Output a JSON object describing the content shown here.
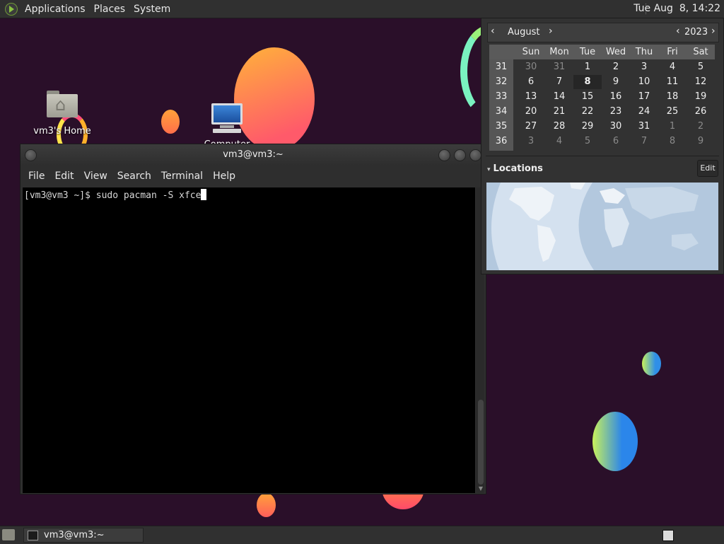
{
  "top_panel": {
    "menus": [
      "Applications",
      "Places",
      "System"
    ],
    "clock": "Tue Aug  8, 14:22"
  },
  "desktop": {
    "icons": [
      {
        "label": "vm3's Home",
        "icon": "home-folder-icon"
      },
      {
        "label": "Computer",
        "icon": "computer-icon"
      }
    ]
  },
  "terminal": {
    "title": "vm3@vm3:~",
    "menu": [
      "File",
      "Edit",
      "View",
      "Search",
      "Terminal",
      "Help"
    ],
    "line": "[vm3@vm3 ~]$ sudo pacman -S xfce"
  },
  "calendar": {
    "month": "August",
    "year": "2023",
    "weekdays": [
      "Sun",
      "Mon",
      "Tue",
      "Wed",
      "Thu",
      "Fri",
      "Sat"
    ],
    "today": "8",
    "weeks": [
      {
        "week": "31",
        "days": [
          "30",
          "31",
          "1",
          "2",
          "3",
          "4",
          "5"
        ],
        "dim": [
          true,
          true,
          false,
          false,
          false,
          false,
          false
        ]
      },
      {
        "week": "32",
        "days": [
          "6",
          "7",
          "8",
          "9",
          "10",
          "11",
          "12"
        ],
        "dim": [
          false,
          false,
          false,
          false,
          false,
          false,
          false
        ]
      },
      {
        "week": "33",
        "days": [
          "13",
          "14",
          "15",
          "16",
          "17",
          "18",
          "19"
        ],
        "dim": [
          false,
          false,
          false,
          false,
          false,
          false,
          false
        ]
      },
      {
        "week": "34",
        "days": [
          "20",
          "21",
          "22",
          "23",
          "24",
          "25",
          "26"
        ],
        "dim": [
          false,
          false,
          false,
          false,
          false,
          false,
          false
        ]
      },
      {
        "week": "35",
        "days": [
          "27",
          "28",
          "29",
          "30",
          "31",
          "1",
          "2"
        ],
        "dim": [
          false,
          false,
          false,
          false,
          false,
          true,
          true
        ]
      },
      {
        "week": "36",
        "days": [
          "3",
          "4",
          "5",
          "6",
          "7",
          "8",
          "9"
        ],
        "dim": [
          true,
          true,
          true,
          true,
          true,
          true,
          true
        ]
      }
    ],
    "locations_label": "Locations",
    "edit_label": "Edit"
  },
  "taskbar": {
    "task_label": "vm3@vm3:~"
  }
}
